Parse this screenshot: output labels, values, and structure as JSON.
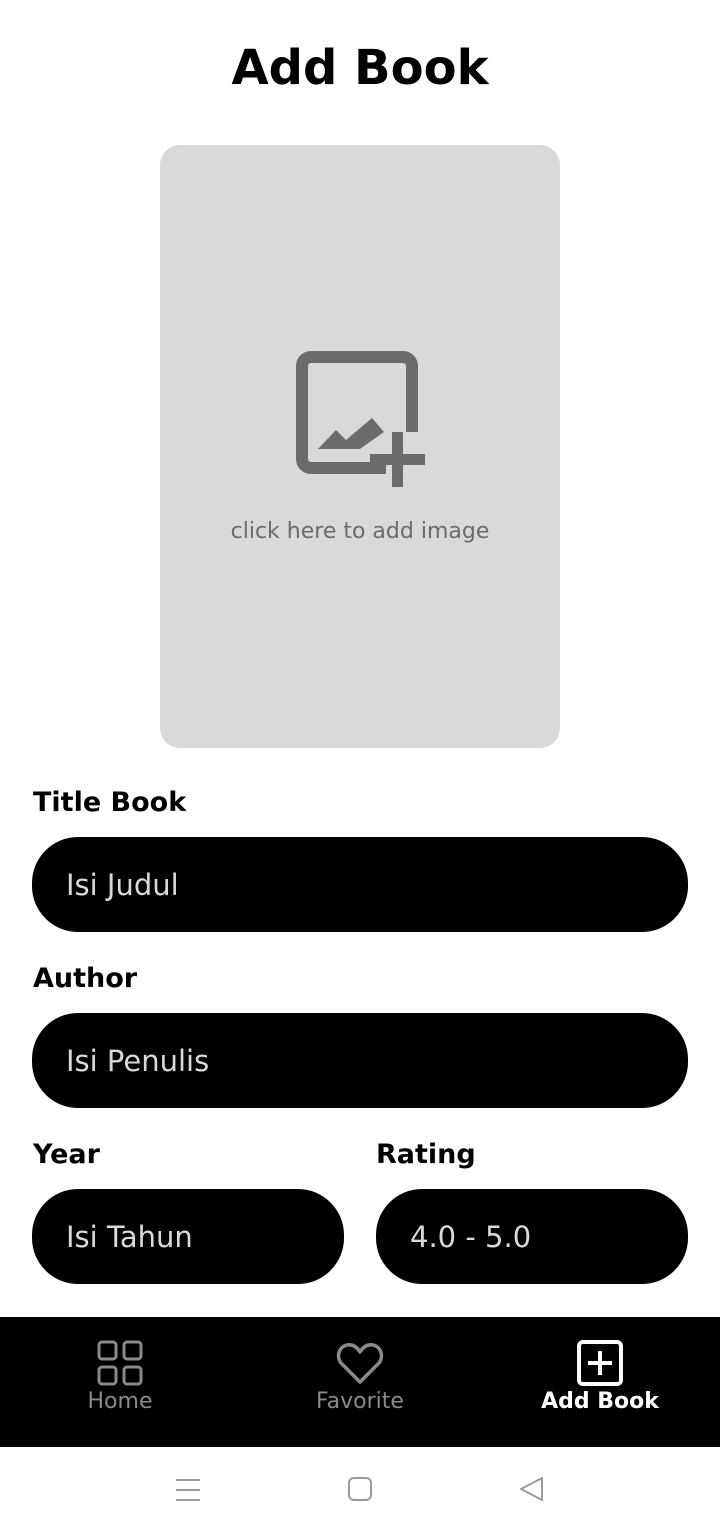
{
  "header": {
    "title": "Add Book"
  },
  "image_picker": {
    "hint": "click here to add image",
    "icon": "add-photo-icon"
  },
  "form": {
    "title": {
      "label": "Title Book",
      "placeholder": "Isi Judul"
    },
    "author": {
      "label": "Author",
      "placeholder": "Isi Penulis"
    },
    "year": {
      "label": "Year",
      "placeholder": "Isi Tahun"
    },
    "rating": {
      "label": "Rating",
      "placeholder": "4.0 - 5.0"
    }
  },
  "bottom_nav": {
    "items": [
      {
        "label": "Home",
        "icon": "grid-icon",
        "active": false
      },
      {
        "label": "Favorite",
        "icon": "heart-icon",
        "active": false
      },
      {
        "label": "Add Book",
        "icon": "add-square-icon",
        "active": true
      }
    ]
  },
  "system_nav": {
    "buttons": [
      "menu-icon",
      "home-square-icon",
      "back-triangle-icon"
    ]
  },
  "colors": {
    "background": "#ffffff",
    "field_bg": "#000000",
    "field_text": "#d9d9d9",
    "picker_bg": "#d9d9d9",
    "nav_bg": "#000000",
    "nav_inactive": "#8a8a8a",
    "nav_active": "#ffffff"
  }
}
